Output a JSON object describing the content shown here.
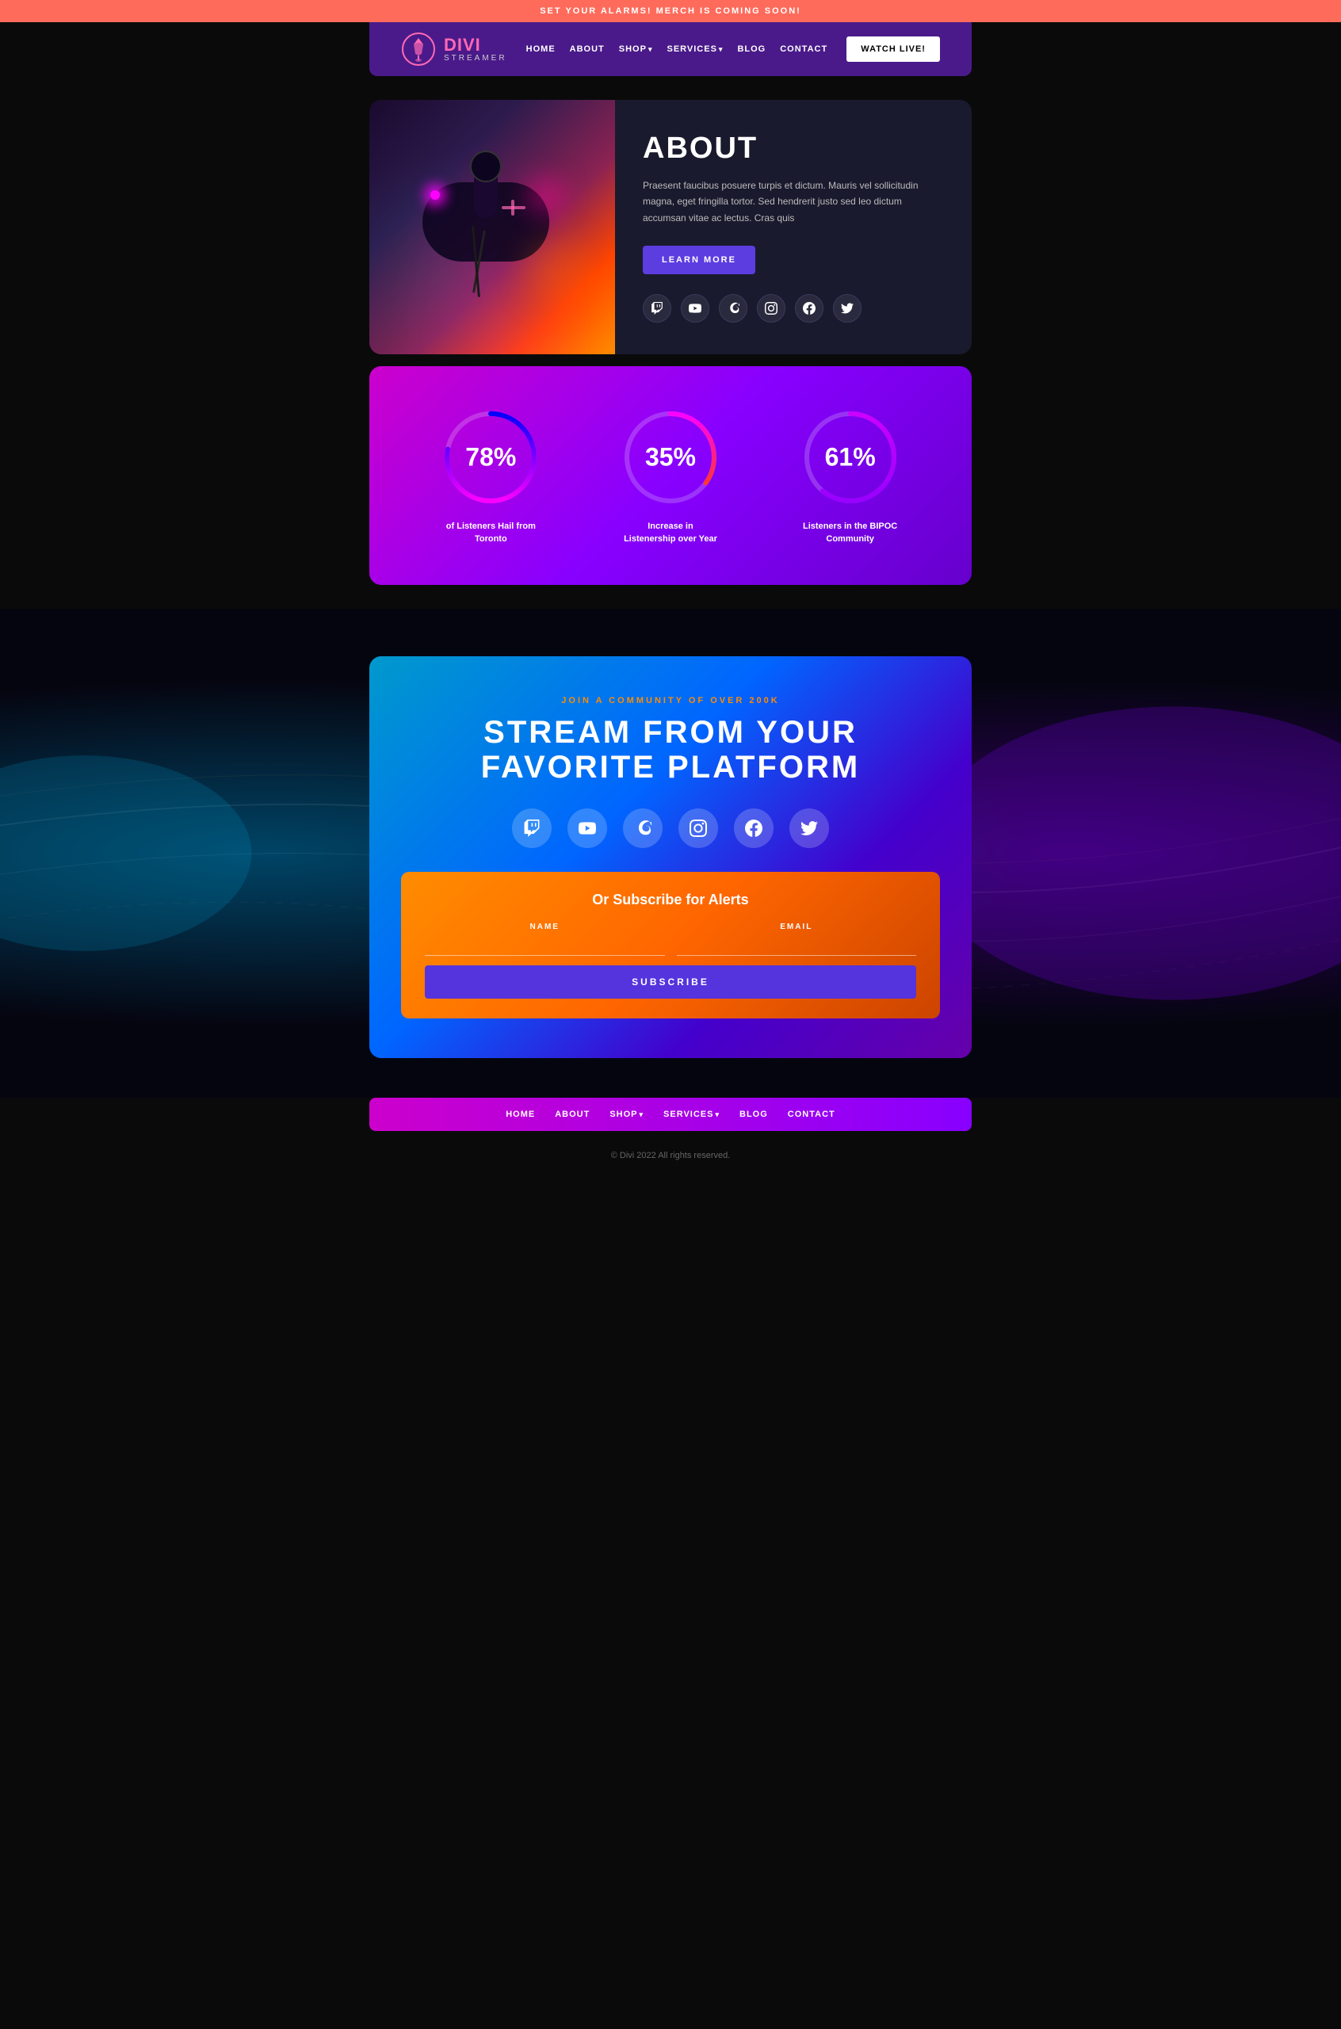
{
  "topBanner": {
    "text": "SET YOUR ALARMS! MERCH IS COMING SOON!"
  },
  "header": {
    "logo": {
      "title": "DIVI",
      "subtitle": "STREAMER"
    },
    "nav": [
      {
        "label": "HOME",
        "hasDropdown": false
      },
      {
        "label": "ABOUT",
        "hasDropdown": false
      },
      {
        "label": "SHOP",
        "hasDropdown": true
      },
      {
        "label": "SERVICES",
        "hasDropdown": true
      },
      {
        "label": "BLOG",
        "hasDropdown": false
      },
      {
        "label": "CONTACT",
        "hasDropdown": false
      }
    ],
    "watchLiveButton": "WATCH LIVE!"
  },
  "about": {
    "title": "ABOUT",
    "text": "Praesent faucibus posuere turpis et dictum. Mauris vel sollicitudin magna, eget fringilla tortor. Sed hendrerit justo sed leo dictum accumsan vitae ac lectus. Cras quis",
    "learnMoreButton": "LEARN MORE",
    "socialIcons": [
      "twitch",
      "youtube",
      "patreon",
      "instagram",
      "facebook",
      "twitter"
    ]
  },
  "stats": [
    {
      "value": "78%",
      "label": "of Listeners Hail from Toronto",
      "percent": 78,
      "circleColor1": "#ff00ff",
      "circleColor2": "#0000ff"
    },
    {
      "value": "35%",
      "label": "Increase in Listenership over Year",
      "percent": 35,
      "circleColor1": "#ff4400",
      "circleColor2": "#ff00ff"
    },
    {
      "value": "61%",
      "label": "Listeners in the BIPOC Community",
      "percent": 61,
      "circleColor1": "#9900ff",
      "circleColor2": "#cc00ff"
    }
  ],
  "streamSection": {
    "subtitle": "JOIN A COMMUNITY OF OVER 200K",
    "title": "STREAM FROM YOUR FAVORITE PLATFORM",
    "socialIcons": [
      "twitch",
      "youtube",
      "patreon",
      "instagram",
      "facebook",
      "twitter"
    ]
  },
  "subscribe": {
    "title": "Or Subscribe for Alerts",
    "namePlaceholder": "",
    "emailPlaceholder": "",
    "nameLabel": "NAME",
    "emailLabel": "EMAIL",
    "button": "SUBSCRIBE"
  },
  "footerNav": [
    {
      "label": "HOME",
      "hasDropdown": false
    },
    {
      "label": "ABOUT",
      "hasDropdown": false
    },
    {
      "label": "SHOP",
      "hasDropdown": true
    },
    {
      "label": "SERVICES",
      "hasDropdown": true
    },
    {
      "label": "BLOG",
      "hasDropdown": false
    },
    {
      "label": "CONTACT",
      "hasDropdown": false
    }
  ],
  "footerCopyright": "© Divi 2022 All rights reserved.",
  "icons": {
    "twitch": "📡",
    "youtube": "▶",
    "patreon": "🅿",
    "instagram": "📷",
    "facebook": "f",
    "twitter": "🐦"
  }
}
